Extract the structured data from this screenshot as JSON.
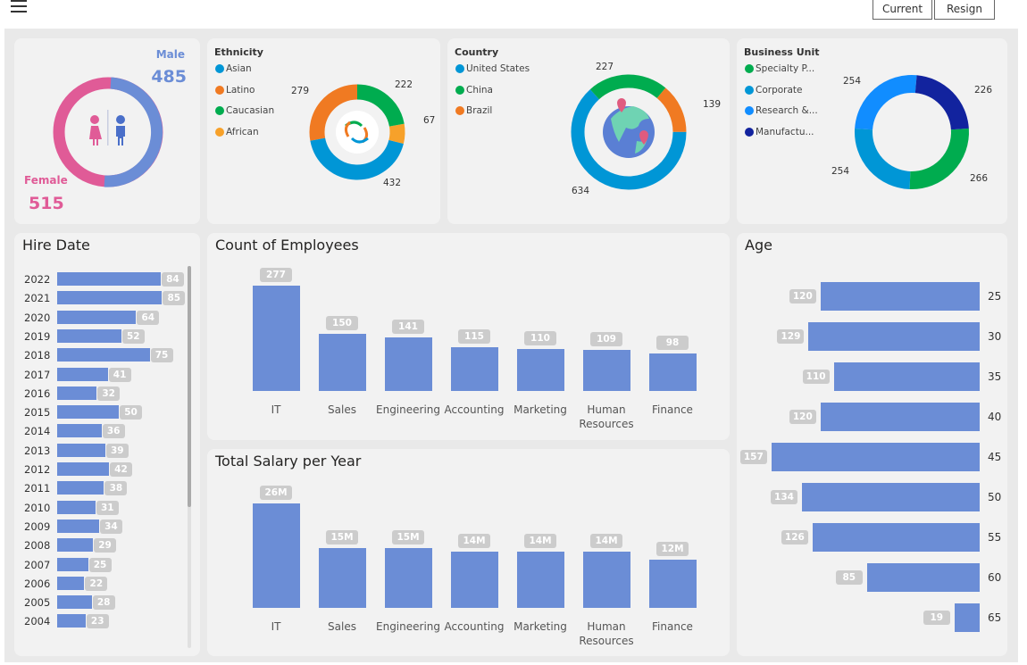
{
  "header": {
    "current_label": "Current",
    "resign_label": "Resign"
  },
  "colors": {
    "bar": "#6b8dd6",
    "male": "#6b8dd6",
    "female": "#e05b97",
    "pill": "#cccccc"
  },
  "gender": {
    "male_label": "Male",
    "male_value": "485",
    "female_label": "Female",
    "female_value": "515"
  },
  "ethnicity": {
    "title": "Ethnicity",
    "items": [
      {
        "label": "Asian",
        "value": 432,
        "color": "#0096d6"
      },
      {
        "label": "Latino",
        "value": 279,
        "color": "#f07a22"
      },
      {
        "label": "Caucasian",
        "value": 222,
        "color": "#00ac4f"
      },
      {
        "label": "African",
        "value": 67,
        "color": "#f7a12a"
      }
    ]
  },
  "country": {
    "title": "Country",
    "items": [
      {
        "label": "United States",
        "value": 634,
        "color": "#0096d6"
      },
      {
        "label": "China",
        "value": 227,
        "color": "#00ac4f"
      },
      {
        "label": "Brazil",
        "value": 139,
        "color": "#f07a22"
      }
    ]
  },
  "business_unit": {
    "title": "Business Unit",
    "items": [
      {
        "label": "Specialty P...",
        "value": 266,
        "color": "#00ac4f"
      },
      {
        "label": "Corporate",
        "value": 254,
        "color": "#0096d6"
      },
      {
        "label": "Research &...",
        "value": 254,
        "color": "#118dff"
      },
      {
        "label": "Manufactu...",
        "value": 226,
        "color": "#12239e"
      }
    ]
  },
  "hire_date": {
    "title": "Hire Date",
    "rows": [
      {
        "year": "2022",
        "value": 84
      },
      {
        "year": "2021",
        "value": 85
      },
      {
        "year": "2020",
        "value": 64
      },
      {
        "year": "2019",
        "value": 52
      },
      {
        "year": "2018",
        "value": 75
      },
      {
        "year": "2017",
        "value": 41
      },
      {
        "year": "2016",
        "value": 32
      },
      {
        "year": "2015",
        "value": 50
      },
      {
        "year": "2014",
        "value": 36
      },
      {
        "year": "2013",
        "value": 39
      },
      {
        "year": "2012",
        "value": 42
      },
      {
        "year": "2011",
        "value": 38
      },
      {
        "year": "2010",
        "value": 31
      },
      {
        "year": "2009",
        "value": 34
      },
      {
        "year": "2008",
        "value": 29
      },
      {
        "year": "2007",
        "value": 25
      },
      {
        "year": "2006",
        "value": 22
      },
      {
        "year": "2005",
        "value": 28
      },
      {
        "year": "2004",
        "value": 23
      }
    ]
  },
  "chart_data": [
    {
      "type": "bar",
      "title": "Count of Employees",
      "categories": [
        "IT",
        "Sales",
        "Engineering",
        "Accounting",
        "Marketing",
        "Human Resources",
        "Finance"
      ],
      "values": [
        277,
        150,
        141,
        115,
        110,
        109,
        98
      ]
    },
    {
      "type": "bar",
      "title": "Total Salary per Year",
      "categories": [
        "IT",
        "Sales",
        "Engineering",
        "Accounting",
        "Marketing",
        "Human Resources",
        "Finance"
      ],
      "values": [
        26,
        15,
        15,
        14,
        14,
        14,
        12
      ],
      "labels": [
        "26M",
        "15M",
        "15M",
        "14M",
        "14M",
        "14M",
        "12M"
      ]
    },
    {
      "type": "bar",
      "orientation": "horizontal",
      "title": "Age",
      "categories": [
        "25",
        "30",
        "35",
        "40",
        "45",
        "50",
        "55",
        "60",
        "65"
      ],
      "values": [
        120,
        129,
        110,
        120,
        157,
        134,
        126,
        85,
        19
      ]
    }
  ]
}
